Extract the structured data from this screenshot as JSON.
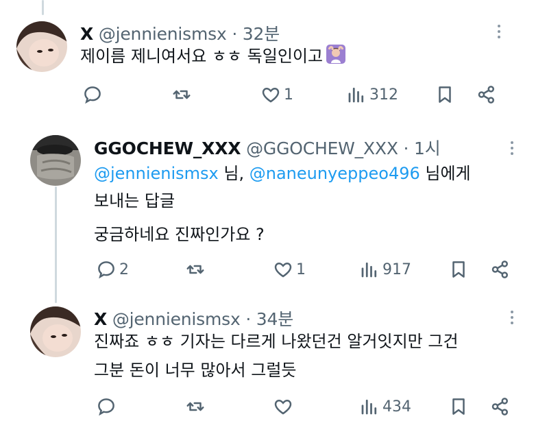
{
  "tweets": [
    {
      "display_name": "X",
      "handle": "@jennienismsx",
      "time": "· 32분",
      "text": "제이름 제니여서요 ㅎㅎ 독일인이고",
      "emoji": "person-gesturing-ok-emoji",
      "reply_count": "",
      "retweet_count": "",
      "like_count": "1",
      "view_count": "312"
    },
    {
      "display_name": "GGOCHEW_XXX",
      "handle": "@GGOCHEW_XXX",
      "time": "· 1시",
      "reply_to_prefix_1": "@jennienismsx",
      "reply_to_mid": " 님, ",
      "reply_to_prefix_2": "@naneunyeppeo496",
      "reply_to_suffix": " 님에게",
      "reply_to_line2": "보내는 답글",
      "text": "궁금하네요 진짜인가요 ?",
      "reply_count": "2",
      "retweet_count": "",
      "like_count": "1",
      "view_count": "917"
    },
    {
      "display_name": "X",
      "handle": "@jennienismsx",
      "time": "· 34분",
      "text_line1": "진짜죠 ㅎㅎ 기자는 다르게 나왔던건 알거잇지만 그건",
      "text_line2": "그분 돈이 너무 많아서 그럴듯",
      "reply_count": "",
      "retweet_count": "",
      "like_count": "",
      "view_count": "434"
    }
  ],
  "colors": {
    "text": "#0f1419",
    "secondary": "#536471",
    "mention": "#1d9bf0",
    "thread": "#cfd9de"
  },
  "icons": [
    "reply-icon",
    "retweet-icon",
    "like-icon",
    "views-icon",
    "bookmark-icon",
    "share-icon",
    "more-icon"
  ]
}
